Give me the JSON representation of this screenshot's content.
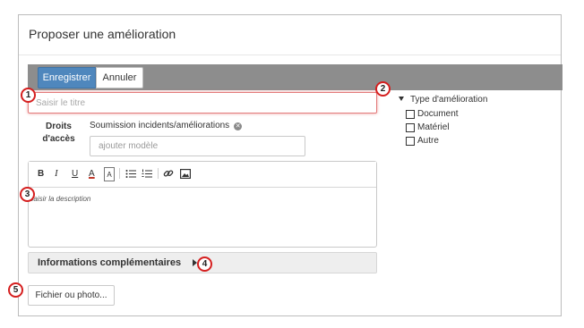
{
  "dialog": {
    "title": "Proposer une amélioration",
    "toolbar": {
      "save_label": "Enregistrer",
      "cancel_label": "Annuler"
    },
    "title_field": {
      "placeholder": "Saisir le titre",
      "value": ""
    },
    "access": {
      "label": "Droits d'accès",
      "tag": "Soumission incidents/améliorations",
      "model_placeholder": "ajouter modèle"
    },
    "editor": {
      "tools": [
        "B",
        "I",
        "U",
        "A",
        "A",
        "bulleted-list",
        "numbered-list",
        "link",
        "image"
      ],
      "description_placeholder": "Saisir la description"
    },
    "more_info_label": "Informations complémentaires",
    "file_button_label": "Fichier ou photo...",
    "improvement_type": {
      "label": "Type d'amélioration",
      "options": [
        "Document",
        "Matériel",
        "Autre"
      ]
    }
  },
  "markers": [
    "1",
    "2",
    "3",
    "4",
    "5"
  ],
  "colors": {
    "save_button": "#4f87bd",
    "toolbar": "#8d8d8d",
    "marker_ring": "#d51f1f",
    "title_error_border": "#e37c7c"
  }
}
